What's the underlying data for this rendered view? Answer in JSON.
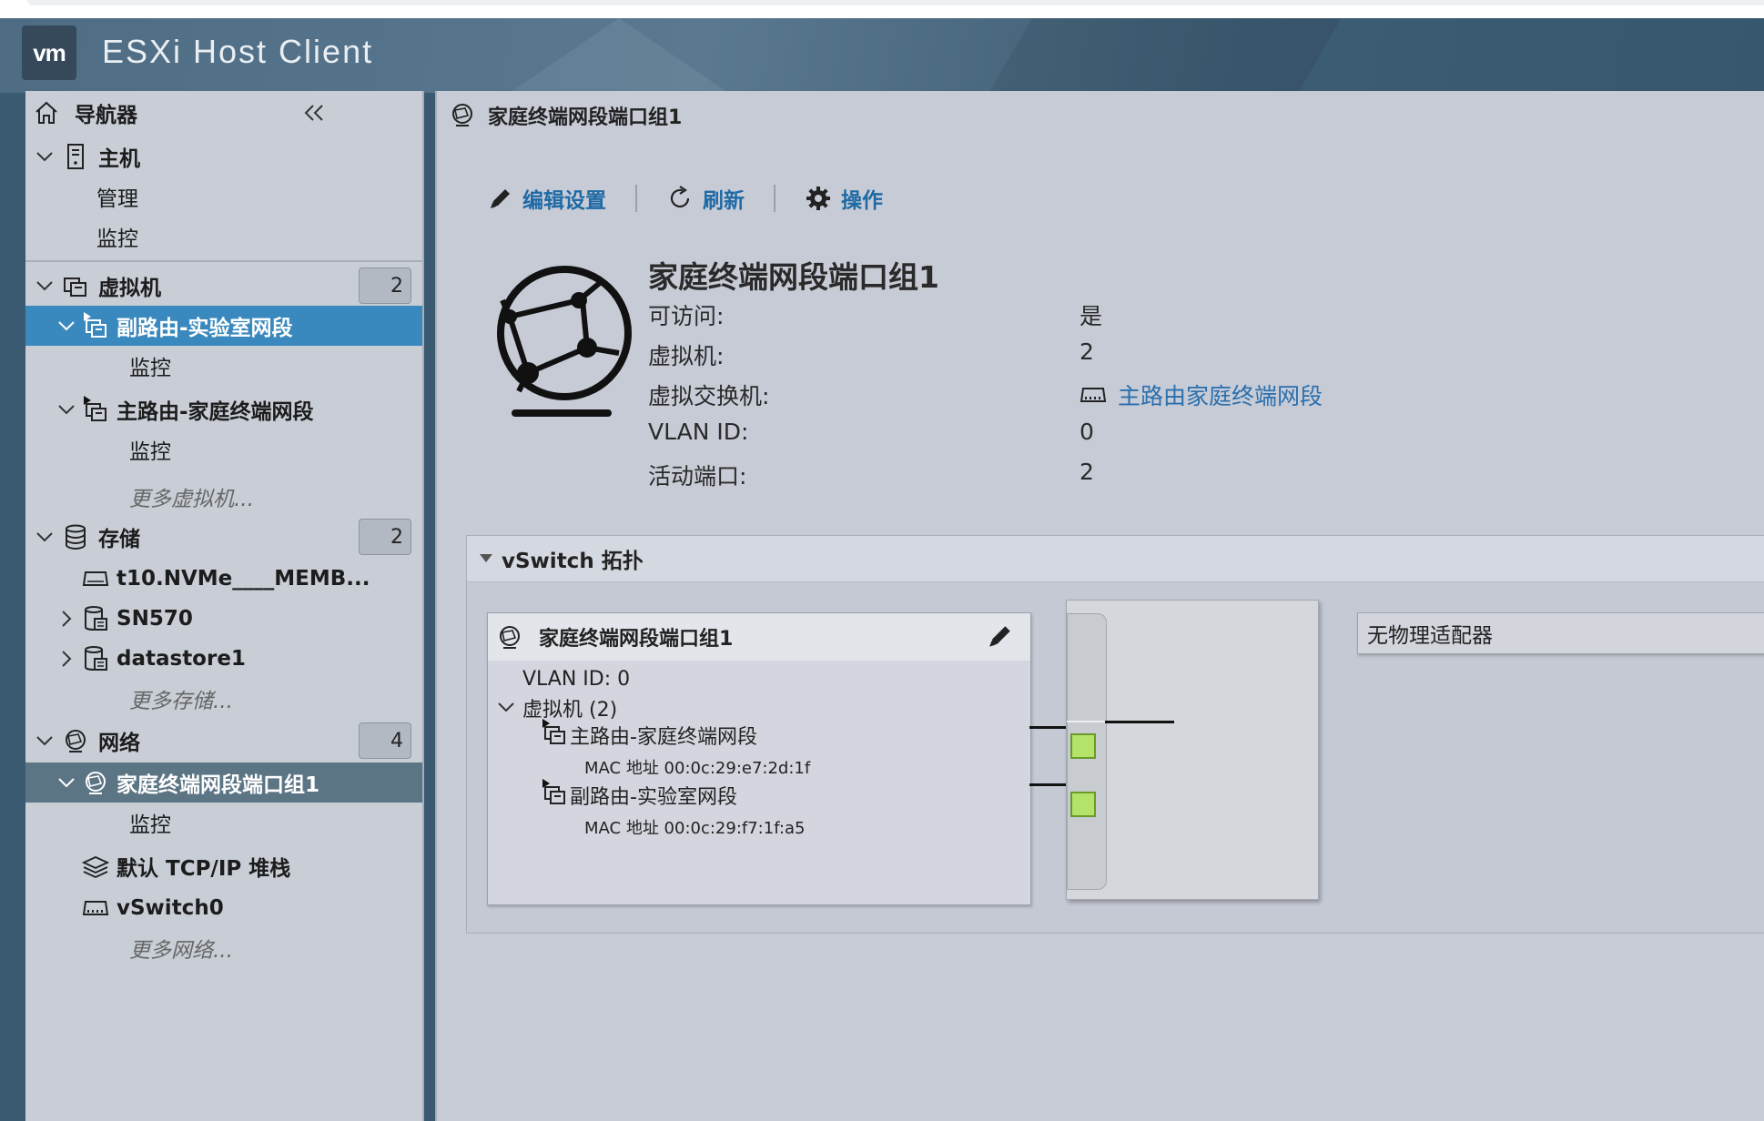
{
  "app": {
    "logo": "vm",
    "title": "ESXi Host Client"
  },
  "navigator": {
    "title": "导航器",
    "host": {
      "label": "主机",
      "children": [
        "管理",
        "监控"
      ]
    },
    "vms": {
      "label": "虚拟机",
      "count": "2",
      "items": [
        {
          "label": "副路由-实验室网段",
          "child": "监控"
        },
        {
          "label": "主路由-家庭终端网段",
          "child": "监控"
        }
      ],
      "more": "更多虚拟机..."
    },
    "storage": {
      "label": "存储",
      "count": "2",
      "items": [
        "t10.NVMe____MEMB...",
        "SN570",
        "datastore1"
      ],
      "more": "更多存储..."
    },
    "network": {
      "label": "网络",
      "count": "4",
      "items": [
        {
          "label": "家庭终端网段端口组1",
          "child": "监控"
        },
        {
          "label": "默认 TCP/IP 堆栈"
        },
        {
          "label": "vSwitch0"
        }
      ],
      "more": "更多网络..."
    }
  },
  "main": {
    "title": "家庭终端网段端口组1",
    "toolbar": {
      "edit": "编辑设置",
      "refresh": "刷新",
      "actions": "操作"
    },
    "summary": {
      "title": "家庭终端网段端口组1",
      "rows": [
        {
          "label": "可访问:",
          "value": "是"
        },
        {
          "label": "虚拟机:",
          "value": "2"
        },
        {
          "label": "虚拟交换机:",
          "value": "主路由家庭终端网段"
        },
        {
          "label": "VLAN ID:",
          "value": "0"
        },
        {
          "label": "活动端口:",
          "value": "2"
        }
      ]
    },
    "topology": {
      "title": "vSwitch 拓扑",
      "portgroup": {
        "name": "家庭终端网段端口组1",
        "vlan": "VLAN ID: 0",
        "vms_label": "虚拟机 (2)",
        "vms": [
          {
            "name": "主路由-家庭终端网段",
            "mac": "MAC 地址 00:0c:29:e7:2d:1f"
          },
          {
            "name": "副路由-实验室网段",
            "mac": "MAC 地址 00:0c:29:f7:1f:a5"
          }
        ]
      },
      "uplink": "无物理适配器"
    }
  },
  "colors": {
    "accent": "#3a89be",
    "link": "#2a6fad",
    "port": "#b5e36a"
  }
}
